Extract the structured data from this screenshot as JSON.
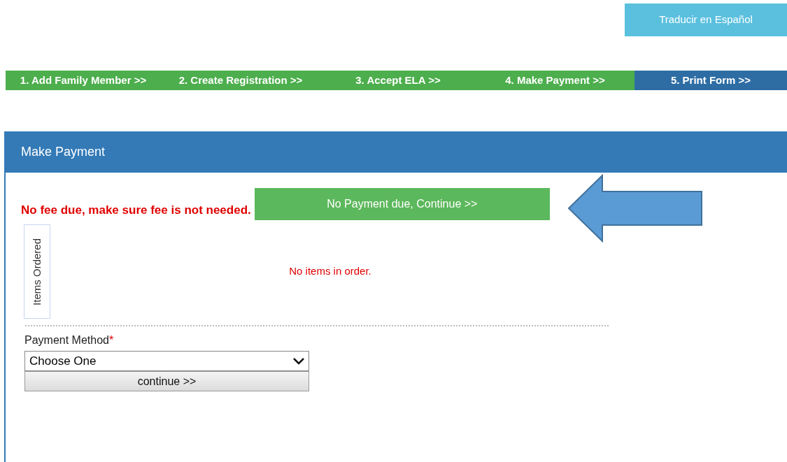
{
  "translate_button": "Traducir en Español",
  "steps": [
    {
      "label": "1. Add Family Member >>",
      "selected": false
    },
    {
      "label": "2. Create Registration >>",
      "selected": false
    },
    {
      "label": "3. Accept ELA >>",
      "selected": false
    },
    {
      "label": "4. Make Payment >>",
      "selected": false
    },
    {
      "label": "5. Print Form >>",
      "selected": true
    }
  ],
  "panel": {
    "title": "Make Payment",
    "notice": "No fee due, make sure fee is not needed.",
    "continue_no_payment_button": "No Payment due, Continue >>",
    "items_legend": "Items Ordered",
    "items_empty": "No items in order.",
    "payment_method_label": "Payment Method",
    "required_mark": "*",
    "payment_method_value": "Choose One",
    "continue_button": "continue >>"
  }
}
